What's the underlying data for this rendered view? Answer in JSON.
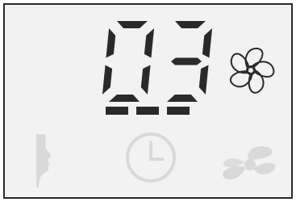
{
  "display": {
    "value": "03",
    "digits": [
      "0",
      "3"
    ],
    "segment_color": "#2a2a2a",
    "dim_color": "#d9d9d9",
    "bar_count": 3
  },
  "icons": {
    "fan_active": "fan-icon",
    "face": "face-profile-icon",
    "timer": "clock-icon",
    "fan_dim": "fan-icon"
  },
  "colors": {
    "background": "#f2f2f2",
    "border": "#2a2a2a",
    "inactive_icon": "#d9d9d9"
  }
}
